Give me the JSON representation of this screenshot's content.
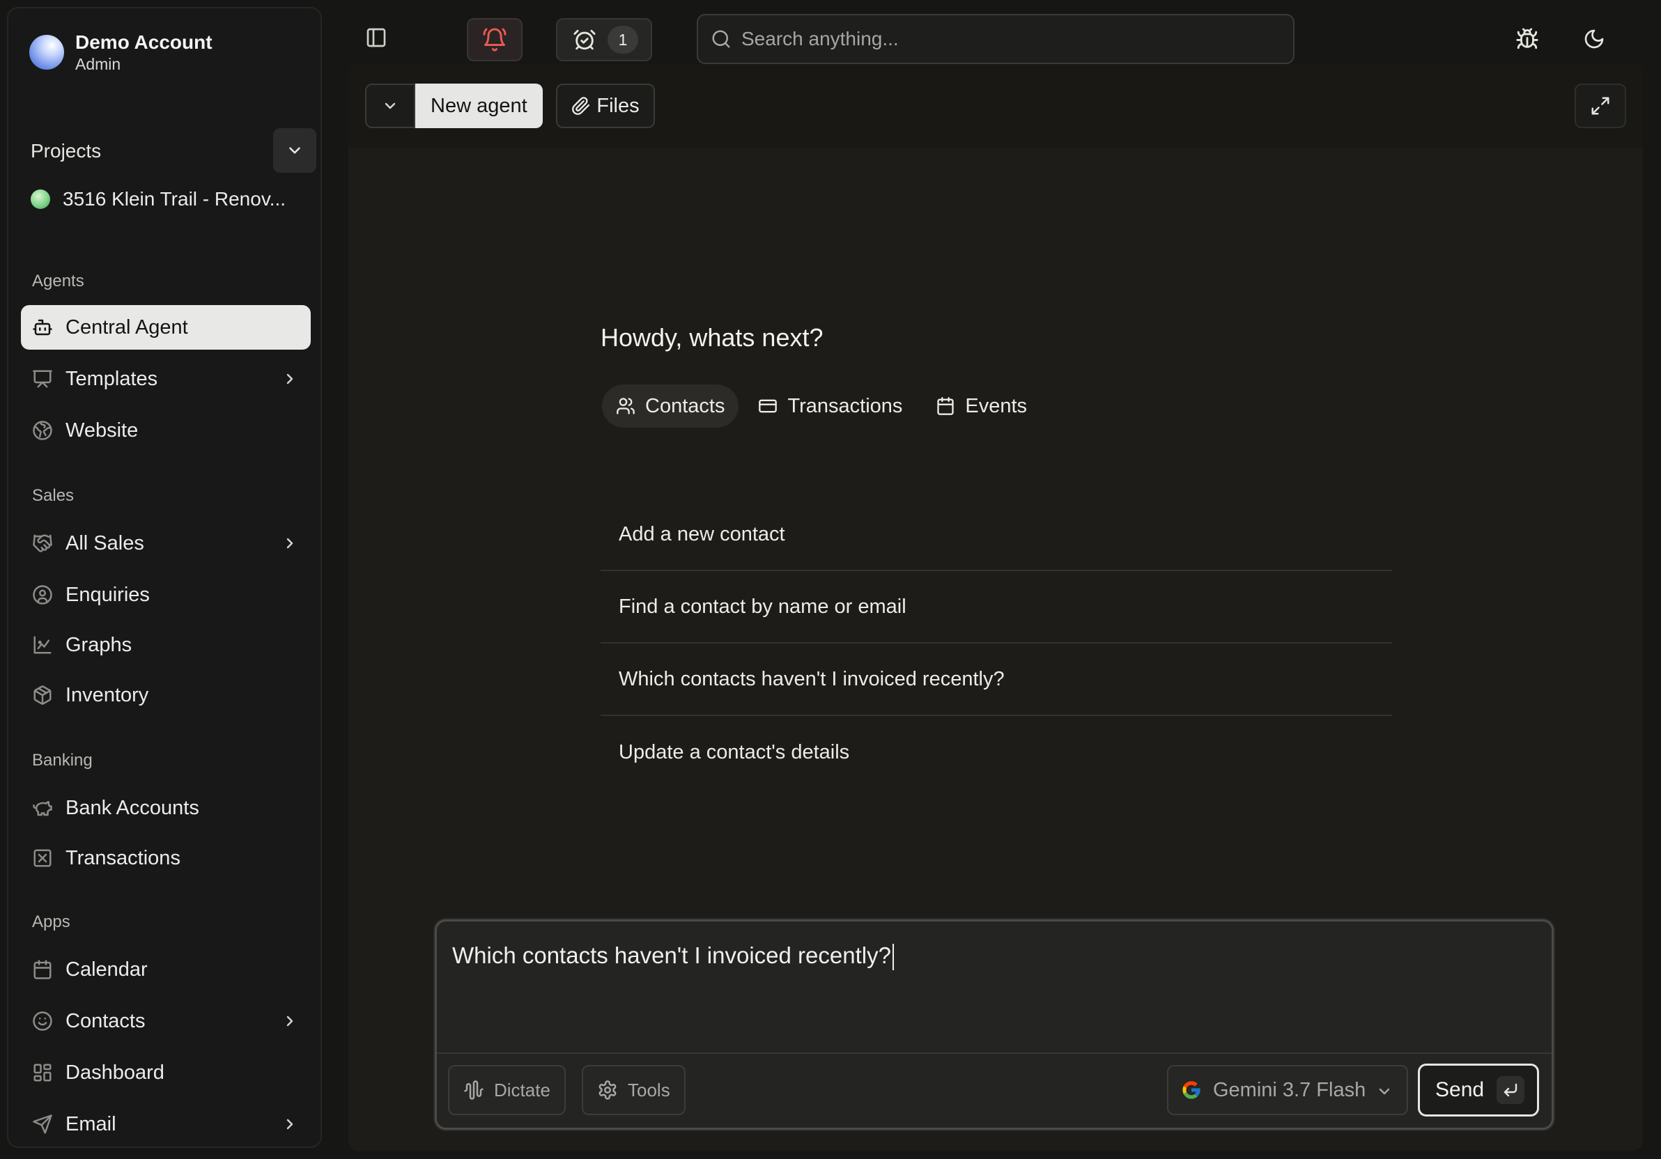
{
  "account": {
    "name": "Demo Account",
    "role": "Admin"
  },
  "projects": {
    "label": "Projects",
    "items": [
      {
        "name": "3516 Klein Trail - Renov..."
      }
    ]
  },
  "sidebar": {
    "sections": [
      {
        "label": "Agents",
        "items": [
          {
            "label": "Central Agent",
            "icon": "bot-icon",
            "active": true
          },
          {
            "label": "Templates",
            "icon": "presentation-icon",
            "has_submenu": true
          },
          {
            "label": "Website",
            "icon": "globe-icon"
          }
        ]
      },
      {
        "label": "Sales",
        "items": [
          {
            "label": "All Sales",
            "icon": "handshake-icon",
            "has_submenu": true
          },
          {
            "label": "Enquiries",
            "icon": "user-circle-icon"
          },
          {
            "label": "Graphs",
            "icon": "chart-icon"
          },
          {
            "label": "Inventory",
            "icon": "box-icon"
          }
        ]
      },
      {
        "label": "Banking",
        "items": [
          {
            "label": "Bank Accounts",
            "icon": "piggy-bank-icon"
          },
          {
            "label": "Transactions",
            "icon": "receipt-x-icon"
          }
        ]
      },
      {
        "label": "Apps",
        "items": [
          {
            "label": "Calendar",
            "icon": "calendar-icon"
          },
          {
            "label": "Contacts",
            "icon": "smile-icon",
            "has_submenu": true
          },
          {
            "label": "Dashboard",
            "icon": "grid-icon"
          },
          {
            "label": "Email",
            "icon": "send-icon",
            "has_submenu": true
          }
        ]
      }
    ]
  },
  "topbar": {
    "alarm_count": "1",
    "search_placeholder": "Search anything..."
  },
  "main": {
    "new_agent_label": "New agent",
    "files_label": "Files",
    "greeting": "Howdy, whats next?",
    "tabs": [
      {
        "label": "Contacts",
        "icon": "users-icon",
        "active": true
      },
      {
        "label": "Transactions",
        "icon": "credit-card-icon"
      },
      {
        "label": "Events",
        "icon": "calendar-icon"
      }
    ],
    "suggestions": [
      "Add a new contact",
      "Find a contact by name or email",
      "Which contacts haven't I invoiced recently?",
      "Update a contact's details"
    ]
  },
  "composer": {
    "text": "Which contacts haven't I invoiced recently?",
    "dictate_label": "Dictate",
    "tools_label": "Tools",
    "model": "Gemini 3.7 Flash",
    "send_label": "Send"
  },
  "colors": {
    "accent_active_bg": "#e8e8e6",
    "bell_red": "#e85a52",
    "background": "#161614"
  }
}
